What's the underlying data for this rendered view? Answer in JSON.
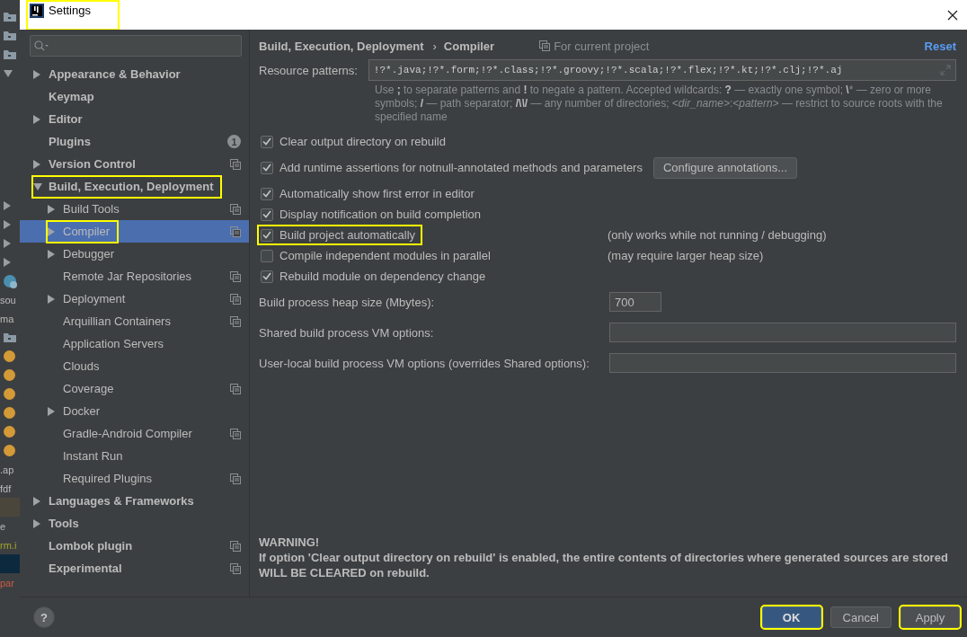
{
  "background_ide": {
    "items": [
      {
        "kind": "folder"
      },
      {
        "kind": "folder"
      },
      {
        "kind": "folder"
      },
      {
        "kind": "arrow_down"
      },
      {
        "kind": "blank"
      },
      {
        "kind": "blank"
      },
      {
        "kind": "blank"
      },
      {
        "kind": "blank"
      },
      {
        "kind": "blank"
      },
      {
        "kind": "blank"
      },
      {
        "kind": "arrow_right"
      },
      {
        "kind": "arrow_right"
      },
      {
        "kind": "arrow_right"
      },
      {
        "kind": "arrow_right"
      },
      {
        "kind": "app"
      },
      {
        "kind": "text",
        "text": "sou"
      },
      {
        "kind": "text",
        "text": "ma"
      },
      {
        "kind": "folder"
      },
      {
        "kind": "dot"
      },
      {
        "kind": "dot"
      },
      {
        "kind": "dot"
      },
      {
        "kind": "dot"
      },
      {
        "kind": "dot"
      },
      {
        "kind": "dot"
      },
      {
        "kind": "text",
        "text": ".ap"
      },
      {
        "kind": "text",
        "text": "fdf"
      },
      {
        "kind": "band",
        "color": "#4b463c"
      },
      {
        "kind": "text",
        "text": "e"
      },
      {
        "kind": "text",
        "text": "rm.i",
        "color": "#a5a52a"
      },
      {
        "kind": "band",
        "color": "#0d293e"
      },
      {
        "kind": "text",
        "text": "par",
        "color": "#cc5a45"
      }
    ]
  },
  "window": {
    "title": "Settings",
    "highlighted": true
  },
  "sidebar": {
    "items": [
      {
        "label": "Appearance & Behavior",
        "expanded": false,
        "selected": false,
        "highlighted": false
      },
      {
        "label": "Keymap",
        "selected": false,
        "highlighted": false
      },
      {
        "label": "Editor",
        "expanded": false,
        "selected": false,
        "highlighted": false
      },
      {
        "label": "Plugins",
        "selected": false,
        "highlighted": false,
        "badge": "1"
      },
      {
        "label": "Version Control",
        "expanded": false,
        "selected": false,
        "highlighted": false,
        "project_scope": true
      },
      {
        "label": "Build, Execution, Deployment",
        "expanded": true,
        "selected": false,
        "highlighted": true,
        "children": [
          {
            "label": "Build Tools",
            "expanded": false,
            "selected": false,
            "highlighted": false,
            "project_scope": true
          },
          {
            "label": "Compiler",
            "expanded": false,
            "selected": true,
            "highlighted": true,
            "project_scope": true
          },
          {
            "label": "Debugger",
            "expanded": false,
            "selected": false,
            "highlighted": false
          },
          {
            "label": "Remote Jar Repositories",
            "selected": false,
            "highlighted": false,
            "project_scope": true
          },
          {
            "label": "Deployment",
            "expanded": false,
            "selected": false,
            "highlighted": false,
            "project_scope": true
          },
          {
            "label": "Arquillian Containers",
            "selected": false,
            "highlighted": false,
            "project_scope": true
          },
          {
            "label": "Application Servers",
            "selected": false,
            "highlighted": false
          },
          {
            "label": "Clouds",
            "selected": false,
            "highlighted": false
          },
          {
            "label": "Coverage",
            "selected": false,
            "highlighted": false,
            "project_scope": true
          },
          {
            "label": "Docker",
            "expanded": false,
            "selected": false,
            "highlighted": false
          },
          {
            "label": "Gradle-Android Compiler",
            "selected": false,
            "highlighted": false,
            "project_scope": true
          },
          {
            "label": "Instant Run",
            "selected": false,
            "highlighted": false
          },
          {
            "label": "Required Plugins",
            "selected": false,
            "highlighted": false,
            "project_scope": true
          }
        ]
      },
      {
        "label": "Languages & Frameworks",
        "expanded": false,
        "selected": false,
        "highlighted": false
      },
      {
        "label": "Tools",
        "expanded": false,
        "selected": false,
        "highlighted": false
      },
      {
        "label": "Lombok plugin",
        "selected": false,
        "highlighted": false,
        "project_scope": true
      },
      {
        "label": "Experimental",
        "selected": false,
        "highlighted": false,
        "project_scope": true
      }
    ]
  },
  "header": {
    "breadcrumb": [
      "Build, Execution, Deployment",
      "Compiler"
    ],
    "separator": "›",
    "scope": "For current project",
    "reset": "Reset"
  },
  "resource_patterns": {
    "label": "Resource patterns:",
    "value": "!?*.java;!?*.form;!?*.class;!?*.groovy;!?*.scala;!?*.flex;!?*.kt;!?*.clj;!?*.aj",
    "help": "Use **;** to separate patterns and **!** to negate a pattern. Accepted wildcards: **?** — exactly one symbol; **\\*** — zero or more symbols; **/** — path separator; **/\\*\\*/** — any number of directories; *<dir_name>*:*<pattern>* — restrict to source roots with the specified name"
  },
  "options": [
    {
      "label": "Clear output directory on rebuild",
      "checked": true,
      "highlighted": false
    },
    {
      "label": "Add runtime assertions for notnull-annotated methods and parameters",
      "checked": true,
      "highlighted": false,
      "button": "Configure annotations..."
    },
    {
      "label": "Automatically show first error in editor",
      "checked": true,
      "highlighted": false
    },
    {
      "label": "Display notification on build completion",
      "checked": true,
      "highlighted": false
    },
    {
      "label": "Build project automatically",
      "checked": true,
      "highlighted": true,
      "note": "(only works while not running / debugging)"
    },
    {
      "label": "Compile independent modules in parallel",
      "checked": false,
      "highlighted": false,
      "note": "(may require larger heap size)"
    },
    {
      "label": "Rebuild module on dependency change",
      "checked": true,
      "highlighted": false
    }
  ],
  "fields": [
    {
      "label": "Build process heap size (Mbytes):",
      "value": "700",
      "kind": "short"
    },
    {
      "label": "Shared build process VM options:",
      "kind": "wide"
    },
    {
      "label": "User-local build process VM options (overrides Shared options):",
      "kind": "wide"
    }
  ],
  "warning": {
    "title": "WARNING!",
    "text": "If option 'Clear output directory on rebuild' is enabled, the entire contents of directories where generated sources are stored WILL BE CLEARED on rebuild."
  },
  "buttons": [
    {
      "label": "OK",
      "kind": "primary",
      "highlighted": true
    },
    {
      "label": "Cancel",
      "kind": "normal",
      "highlighted": false
    },
    {
      "label": "Apply",
      "kind": "normal",
      "highlighted": true
    }
  ],
  "help_button": "?"
}
